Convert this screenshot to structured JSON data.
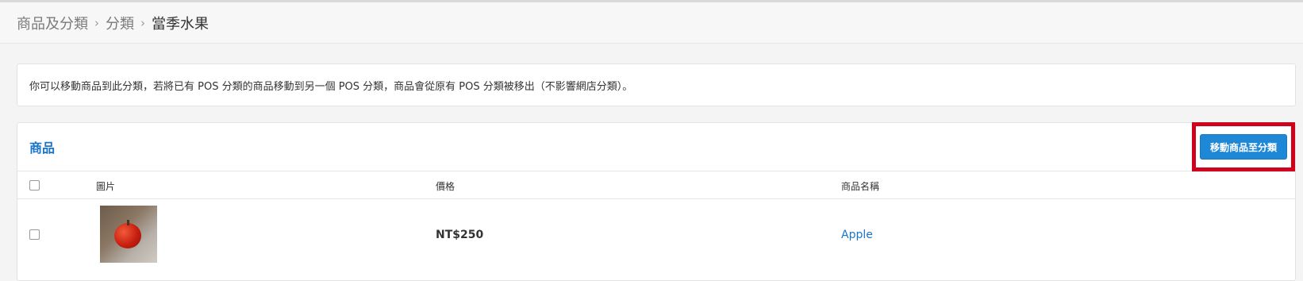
{
  "breadcrumb": {
    "items": [
      "商品及分類",
      "分類",
      "當季水果"
    ],
    "separator": "›"
  },
  "notice": {
    "text": "你可以移動商品到此分類，若將已有 POS 分類的商品移動到另一個 POS 分類，商品會從原有 POS 分類被移出（不影響網店分類）。"
  },
  "panel": {
    "title": "商品",
    "move_button_label": "移動商品至分類"
  },
  "table": {
    "columns": [
      "圖片",
      "價格",
      "商品名稱"
    ],
    "rows": [
      {
        "image": "apple-photo",
        "price": "NT$250",
        "name": "Apple"
      }
    ]
  },
  "colors": {
    "accent": "#1a75c9",
    "button": "#1e88d6",
    "highlight": "#d0021b"
  }
}
